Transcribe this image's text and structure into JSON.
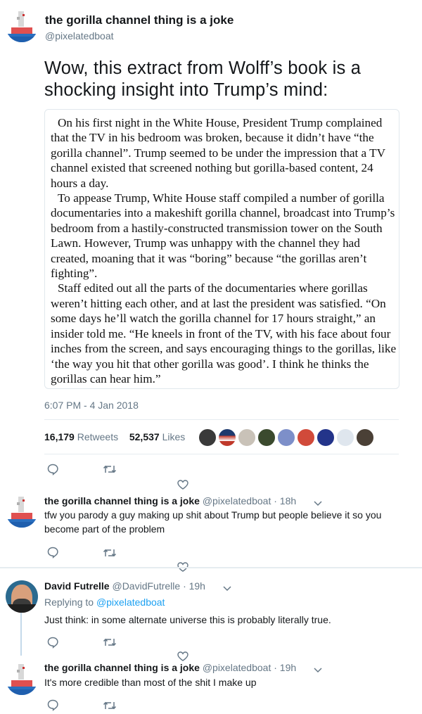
{
  "main_tweet": {
    "display_name": "the gorilla channel thing is a joke",
    "handle": "@pixelatedboat",
    "text": "Wow, this extract from Wolff’s book is a shocking insight into Trump’s mind:",
    "quote_paragraphs": [
      "On his first night in the White House, President Trump complained that the TV in his bedroom was broken, because it didn’t have “the gorilla channel”. Trump seemed to be under the impression that a TV channel existed that screened nothing but gorilla-based content, 24 hours a day.",
      "To appease Trump, White House staff compiled a number of gorilla documentaries into a makeshift gorilla channel, broadcast into Trump’s bedroom from a hastily-constructed transmission tower on the South Lawn. However, Trump was unhappy with the channel they had created, moaning that it was “boring” because “the gorillas aren’t fighting”.",
      "Staff edited out all the parts of the documentaries where gorillas weren’t hitting each other, and at last the president was satisfied. “On some days he’ll watch the gorilla channel for 17 hours straight,” an insider told me. “He kneels in front of the TV, with his face about four inches from the screen, and says encouraging things to the gorillas, like ‘the way you hit that other gorilla was good’. I think he thinks the gorillas can hear him.”"
    ],
    "timestamp": "6:07 PM - 4 Jan 2018",
    "retweets_count": "16,179",
    "retweets_label": "Retweets",
    "likes_count": "52,537",
    "likes_label": "Likes"
  },
  "replies": [
    {
      "display_name": "the gorilla channel thing is a joke",
      "handle": "@pixelatedboat",
      "time": "· 18h",
      "text_line1": "tfw you parody a guy making up shit about Trump but people believe it so you",
      "text_line2": "become part of the problem"
    },
    {
      "display_name": "David Futrelle",
      "handle": "@DavidFutrelle",
      "time": "· 19h",
      "replying_prefix": "Replying to",
      "replying_to": "@pixelatedboat",
      "text": "Just think: in some alternate universe this is probably literally true."
    },
    {
      "display_name": "the gorilla channel thing is a joke",
      "handle": "@pixelatedboat",
      "time": "· 19h",
      "text": "It's more credible than most of the shit I make up"
    }
  ],
  "icons": [
    "boat-avatar-icon",
    "reply-icon",
    "retweet-icon",
    "like-icon",
    "chevron-down-icon"
  ],
  "colors": {
    "link": "#1da1f2",
    "muted": "#657786",
    "thread_line": "#c5d9ea",
    "divider": "#e6ecf0"
  }
}
